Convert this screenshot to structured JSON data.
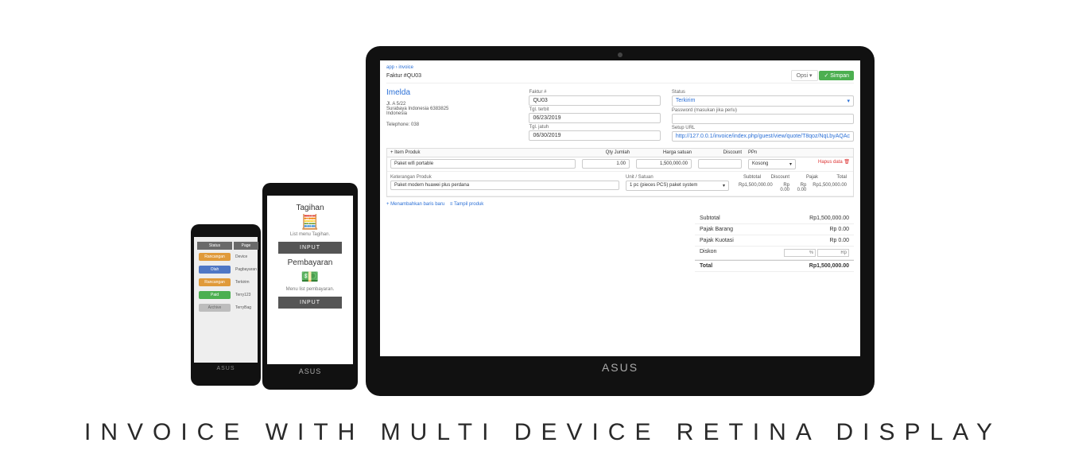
{
  "caption": "INVOICE WITH MULTI DEVICE RETINA DISPLAY",
  "brand": "ASUS",
  "laptop": {
    "breadcrumb": "app › invoice",
    "title_prefix": "Faktur #",
    "invoice_no_top": "QU03",
    "btn_opsi": "Opsi ▾",
    "btn_simpan": "✓ Simpan",
    "customer": {
      "name": "Imelda",
      "address_line": "Jl. A 5/22",
      "city": "Surabaya Indonesia 6383825",
      "country": "Indonesia",
      "phone_label": "Telephone:",
      "phone": "038"
    },
    "fields": {
      "faktur_label": "Faktur #",
      "faktur_value": "QU03",
      "tgl_terbit_label": "Tgl. terbit",
      "tgl_terbit_value": "06/23/2019",
      "tgl_jatuh_label": "Tgl. jatuh",
      "tgl_jatuh_value": "06/30/2019",
      "status_label": "Status",
      "status_value": "Terkirim",
      "password_label": "Password (masukan jika perlu)",
      "setup_label": "Setup URL",
      "setup_value": "http://127.0.0.1/invoice/index.php/guest/view/quote/T8qoz/NqLbyAQAc"
    },
    "items": {
      "hdr_item": "+  Item Produk",
      "hdr_qty": "Qty Jumlah",
      "hdr_price": "Harga satuan",
      "hdr_disc": "Discount",
      "hdr_ppn": "PPn",
      "row": {
        "name": "Paket wifi portable",
        "qty": "1.00",
        "price": "1,500,000.00",
        "disc": "",
        "ppn": "Kosong",
        "delete": "Hapus data 🗑"
      },
      "desc_label": "Keterangan Produk",
      "unit_label": "Unit / Satuan",
      "desc_value": "Paket modem huawei plus perdana",
      "unit_value": "1 pc (pieces PCS) paket system",
      "sub_subtotal_label": "Subtotal",
      "sub_subtotal": "Rp1,500,000.00",
      "sub_discount_label": "Discount",
      "sub_discount": "Rp 0.00",
      "sub_pajak_label": "Pajak",
      "sub_pajak": "Rp 0.00",
      "sub_total_label": "Total",
      "sub_total": "Rp1,500,000.00",
      "add_row": "+ Menambahkan baris baru",
      "show_prod": "≡ Tampil produk"
    },
    "totals": {
      "subtotal_label": "Subtotal",
      "subtotal": "Rp1,500,000.00",
      "pajak_barang_label": "Pajak Barang",
      "pajak_barang": "Rp 0.00",
      "pajak_kuotasi_label": "Pajak Kuotasi",
      "pajak_kuotasi": "Rp 0.00",
      "diskon_label": "Diskon",
      "diskon_pct": "%",
      "diskon_rp": "Rp",
      "total_label": "Total",
      "total": "Rp1,500,000.00"
    }
  },
  "tablet": {
    "section1_title": "Tagihan",
    "section1_sub": "List menu Tagihan.",
    "section2_title": "Pembayaran",
    "section2_sub": "Menu list pembayaran.",
    "btn": "INPUT"
  },
  "phone": {
    "col_status": "Status",
    "col_page": "Page",
    "rows": [
      {
        "pill": "Rancangan",
        "cls": "pill-orange",
        "page": "Device"
      },
      {
        "pill": "Olah",
        "cls": "pill-blue",
        "page": "Pagbayaran"
      },
      {
        "pill": "Rancangan",
        "cls": "pill-orange",
        "page": "Terkirim"
      },
      {
        "pill": "Paid",
        "cls": "pill-green",
        "page": "Terry123"
      },
      {
        "pill": "Archive",
        "cls": "pill-grey",
        "page": "TerryBag"
      }
    ]
  }
}
